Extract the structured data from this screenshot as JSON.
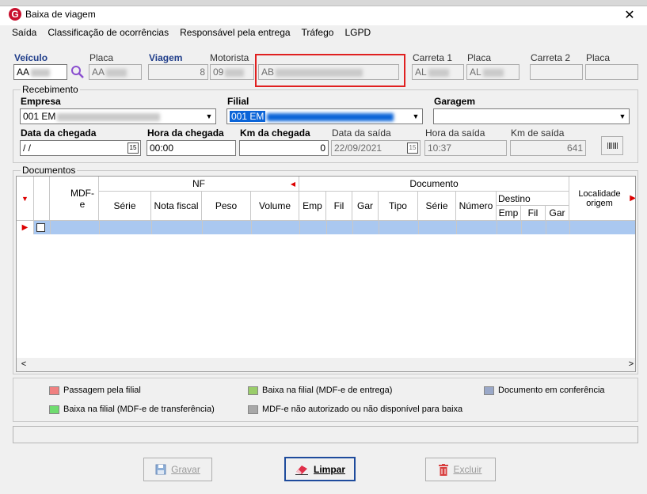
{
  "window": {
    "title": "Baixa de viagem",
    "close_glyph": "✕",
    "app_icon_letter": "G"
  },
  "menu": [
    "Saída",
    "Classificação de ocorrências",
    "Responsável pela entrega",
    "Tráfego",
    "LGPD"
  ],
  "vehicle": {
    "veiculo_label": "Veículo",
    "veiculo_value": "AA",
    "placa_label": "Placa",
    "placa_value": "AA",
    "viagem_label": "Viagem",
    "viagem_value": "8",
    "motorista_label": "Motorista",
    "motorista_code": "09",
    "motorista_name": "AB",
    "carreta1_label": "Carreta 1",
    "carreta1_value": "AL",
    "placa2_label": "Placa",
    "placa2_value": "AL",
    "carreta2_label": "Carreta 2",
    "placa3_label": "Placa"
  },
  "recebimento": {
    "group_label": "Recebimento",
    "empresa_label": "Empresa",
    "empresa_value": "001 EM",
    "filial_label": "Filial",
    "filial_value": "001 EM",
    "garagem_label": "Garagem",
    "garagem_value": "",
    "data_chegada_label": "Data da chegada",
    "data_chegada_value": " / /",
    "hora_chegada_label": "Hora da chegada",
    "hora_chegada_value": "00:00",
    "km_chegada_label": "Km da chegada",
    "km_chegada_value": "0",
    "data_saida_label": "Data da saída",
    "data_saida_value": "22/09/2021",
    "hora_saida_label": "Hora da saída",
    "hora_saida_value": "10:37",
    "km_saida_label": "Km de saída",
    "km_saida_value": "641",
    "calendar_glyph": "15"
  },
  "documentos": {
    "group_label": "Documentos",
    "headers": {
      "mdfe": "MDF-e",
      "nf": "NF",
      "documento": "Documento",
      "nf_cols": [
        "Série",
        "Nota fiscal",
        "Peso",
        "Volume"
      ],
      "doc_cols": [
        "Emp",
        "Fil",
        "Gar",
        "Tipo",
        "Série",
        "Número"
      ],
      "destino": "Destino",
      "destino_cols": [
        "Emp",
        "Fil",
        "Gar"
      ],
      "localidade": "Localidade origem"
    },
    "scroll": {
      "left": "<",
      "right": ">",
      "down": "∨"
    }
  },
  "legend": [
    {
      "label": "Passagem pela filial",
      "color": "#f08080"
    },
    {
      "label": "Baixa na filial (MDF-e de entrega)",
      "color": "#9acd6a"
    },
    {
      "label": "Documento em conferência",
      "color": "#9aa8c8"
    },
    {
      "label": "Baixa na filial (MDF-e de transferência)",
      "color": "#6fdc6f"
    },
    {
      "label": "MDF-e não autorizado ou não disponível para baixa",
      "color": "#a8a8a8"
    }
  ],
  "buttons": {
    "gravar": "Gravar",
    "limpar": "Limpar",
    "excluir": "Excluir"
  }
}
